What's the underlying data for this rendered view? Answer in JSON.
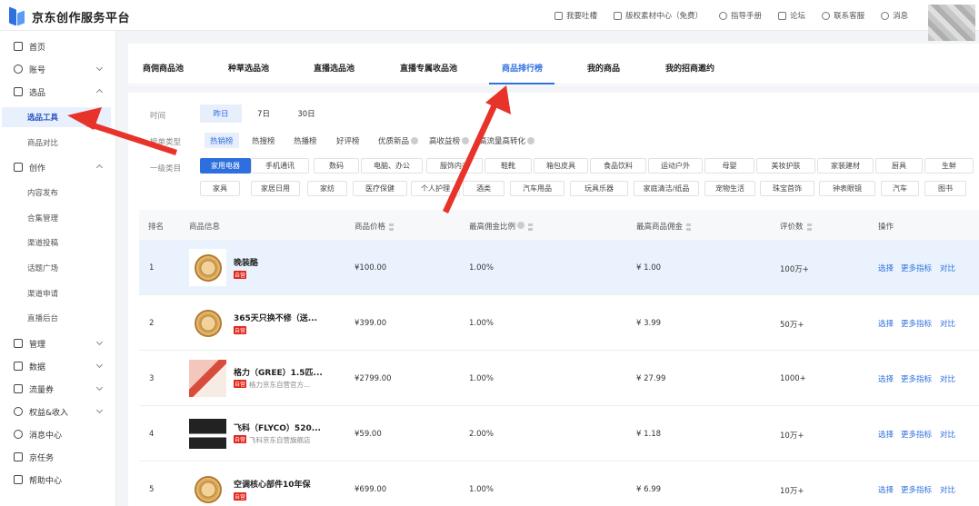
{
  "header": {
    "logo_text": "京东创作服务平台",
    "nav": [
      {
        "label": "我要吐槽",
        "icon": "feedback-icon"
      },
      {
        "label": "版权素材中心（免费）",
        "icon": "image-icon"
      },
      {
        "label": "指导手册",
        "icon": "location-icon"
      },
      {
        "label": "论坛",
        "icon": "book-icon"
      },
      {
        "label": "联系客服",
        "icon": "headset-icon"
      },
      {
        "label": "消息",
        "icon": "message-icon"
      }
    ]
  },
  "sidebar": {
    "items": [
      {
        "label": "首页",
        "icon": "home-icon"
      },
      {
        "label": "账号",
        "icon": "user-icon",
        "expandable": true
      },
      {
        "label": "选品",
        "icon": "scan-icon",
        "expanded": true
      },
      {
        "label": "选品工具",
        "sub": true,
        "active": true
      },
      {
        "label": "商品对比",
        "sub": true
      },
      {
        "label": "创作",
        "icon": "folder-icon",
        "expanded": true
      },
      {
        "label": "内容发布",
        "sub": true
      },
      {
        "label": "合集管理",
        "sub": true
      },
      {
        "label": "渠道投稿",
        "sub": true
      },
      {
        "label": "话题广场",
        "sub": true
      },
      {
        "label": "渠道申请",
        "sub": true
      },
      {
        "label": "直播后台",
        "sub": true
      },
      {
        "label": "管理",
        "icon": "manage-icon",
        "expandable": true
      },
      {
        "label": "数据",
        "icon": "chart-icon",
        "expandable": true
      },
      {
        "label": "流量券",
        "icon": "coupon-icon",
        "expandable": true
      },
      {
        "label": "权益&收入",
        "icon": "money-icon",
        "expandable": true
      },
      {
        "label": "消息中心",
        "icon": "chat-icon"
      },
      {
        "label": "京任务",
        "icon": "mail-icon"
      },
      {
        "label": "帮助中心",
        "icon": "help-icon"
      }
    ]
  },
  "tabs": [
    "商佣商品池",
    "种草选品池",
    "直播选品池",
    "直播专属收品池",
    "商品排行榜",
    "我的商品",
    "我的招商邀约"
  ],
  "active_tab": "商品排行榜",
  "filters": {
    "time_label": "时间",
    "time_options": [
      "昨日",
      "7日",
      "30日"
    ],
    "rank_label": "榜单类型",
    "rank_options": [
      "热销榜",
      "热搜榜",
      "热播榜",
      "好评榜",
      "优质新品",
      "高收益榜",
      "高流量高转化"
    ],
    "category_label": "一级类目",
    "categories_row1": [
      "家用电器",
      "手机通讯",
      "数码",
      "电脑、办公",
      "服饰内衣",
      "鞋靴",
      "箱包皮具",
      "食品饮料",
      "运动户外",
      "母婴",
      "美妆护肤",
      "家装建材",
      "厨具",
      "生鲜"
    ],
    "categories_row2": [
      "家具",
      "家居日用",
      "家纺",
      "医疗保健",
      "个人护理",
      "酒类",
      "汽车用品",
      "玩具乐器",
      "家庭清洁/纸品",
      "宠物生活",
      "珠宝首饰",
      "钟表眼镜",
      "汽车",
      "图书"
    ]
  },
  "table": {
    "headers": [
      "排名",
      "商品信息",
      "商品价格",
      "最高佣金比例",
      "最高商品佣金",
      "评价数",
      "操作"
    ],
    "tag": "自营",
    "actions": [
      "选择",
      "更多指标",
      "对比"
    ],
    "rows": [
      {
        "rank": "1",
        "name": "晚装酪",
        "store": "",
        "price": "¥100.00",
        "rate": "1.00%",
        "commission": "¥ 1.00",
        "reviews": "100万+",
        "thumb": "badge"
      },
      {
        "rank": "2",
        "name": "365天只换不修（送...",
        "store": "",
        "price": "¥399.00",
        "rate": "1.00%",
        "commission": "¥ 3.99",
        "reviews": "50万+",
        "thumb": "badge"
      },
      {
        "rank": "3",
        "name": "格力（GREE）1.5匹...",
        "store": "格力京东自营官方...",
        "price": "¥2799.00",
        "rate": "1.00%",
        "commission": "¥ 27.99",
        "reviews": "1000+",
        "thumb": "ac"
      },
      {
        "rank": "4",
        "name": "飞科（FLYCO）520...",
        "store": "飞科京东自营旗舰店",
        "price": "¥59.00",
        "rate": "2.00%",
        "commission": "¥ 1.18",
        "reviews": "10万+",
        "thumb": "tv"
      },
      {
        "rank": "5",
        "name": "空调核心部件10年保",
        "store": "",
        "price": "¥699.00",
        "rate": "1.00%",
        "commission": "¥ 6.99",
        "reviews": "10万+",
        "thumb": "badge"
      }
    ]
  },
  "colors": {
    "accent": "#2d6fde",
    "tag_red": "#e2231a",
    "highlight_row": "#eaf3fd",
    "arrow_red": "#e8332a"
  }
}
